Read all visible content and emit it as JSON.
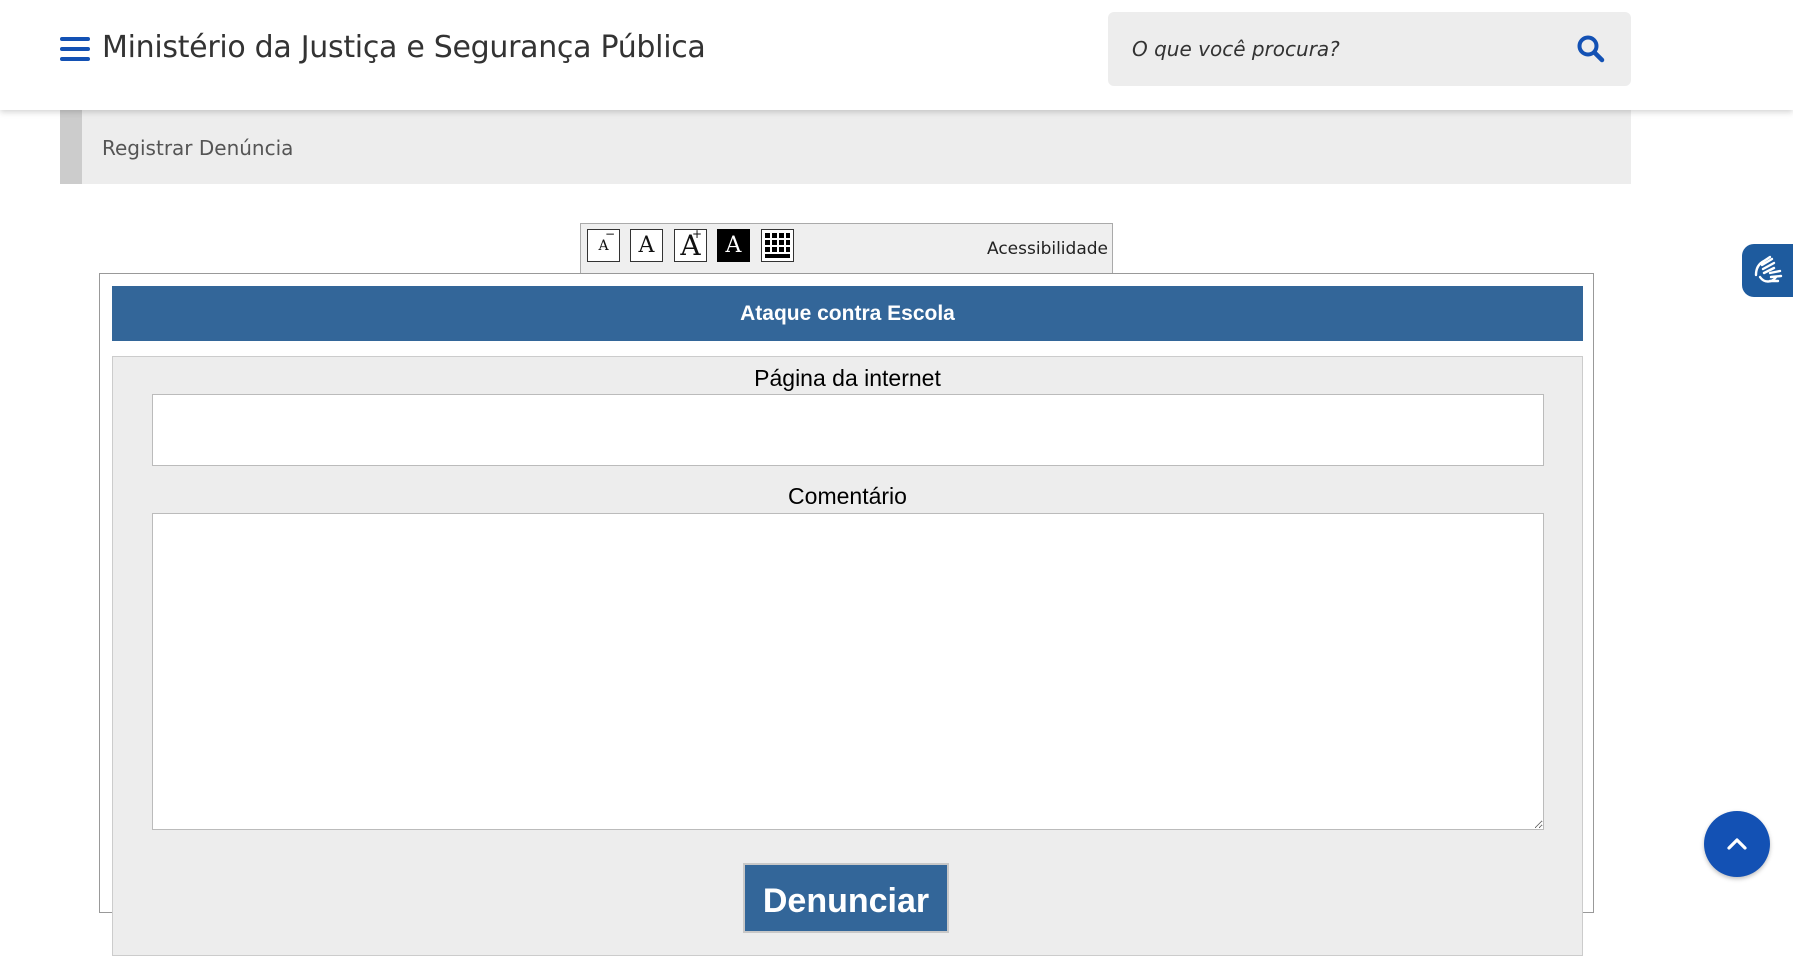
{
  "header": {
    "site_title": "Ministério da Justiça e Segurança Pública",
    "search_placeholder": "O que você procura?"
  },
  "breadcrumb": {
    "current": "Registrar Denúncia"
  },
  "accessibility_bar": {
    "label": "Acessibilidade",
    "buttons": [
      {
        "name": "decrease-font",
        "glyph": "A"
      },
      {
        "name": "normal-font",
        "glyph": "A"
      },
      {
        "name": "increase-font",
        "glyph": "A"
      },
      {
        "name": "high-contrast",
        "glyph": "A"
      },
      {
        "name": "virtual-keyboard",
        "icon": "keyboard-icon"
      }
    ]
  },
  "form": {
    "title": "Ataque contra Escola",
    "url_label": "Página da internet",
    "url_value": "",
    "comment_label": "Comentário",
    "comment_value": "",
    "submit_label": "Denunciar"
  },
  "colors": {
    "brand_blue": "#1351b4",
    "form_blue": "#336699",
    "panel_gray": "#ededed"
  },
  "icons": {
    "menu": "hamburger-menu-icon",
    "search": "search-icon",
    "vlibras": "sign-language-icon",
    "back_to_top": "chevron-up-icon"
  }
}
